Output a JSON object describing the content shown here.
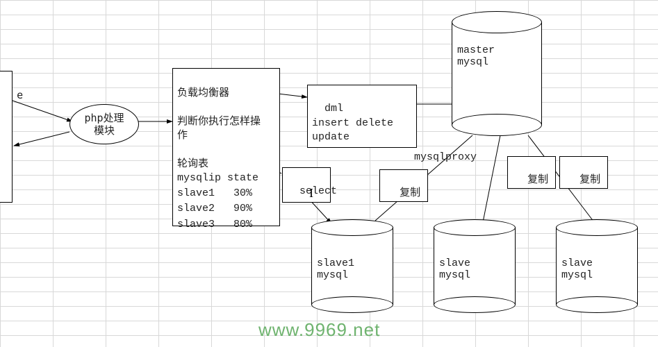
{
  "left_box": {
    "text": "e"
  },
  "php_module": {
    "line1": "php处理",
    "line2": "模块"
  },
  "load_balancer": {
    "title": "负载均衡器",
    "decision": "判断你执行怎样操\n作",
    "poll_header": "轮询表",
    "table_header": "mysqlip state",
    "rows": [
      {
        "name": "slave1",
        "pct": "30%"
      },
      {
        "name": "slave2",
        "pct": "90%"
      },
      {
        "name": "slave3",
        "pct": "80%"
      }
    ]
  },
  "dml_box": {
    "text": "dml\ninsert delete\nupdate"
  },
  "select_box": {
    "text": "select"
  },
  "master": {
    "label": "master\nmysql"
  },
  "slaves": [
    {
      "label": "slave1\nmysql"
    },
    {
      "label": "slave\nmysql"
    },
    {
      "label": "slave\nmysql"
    }
  ],
  "mysqlproxy": "mysqlproxy",
  "replicate": {
    "b1": "复制",
    "b2": "复制",
    "b3": "复制"
  },
  "watermark": "www.9969.net"
}
